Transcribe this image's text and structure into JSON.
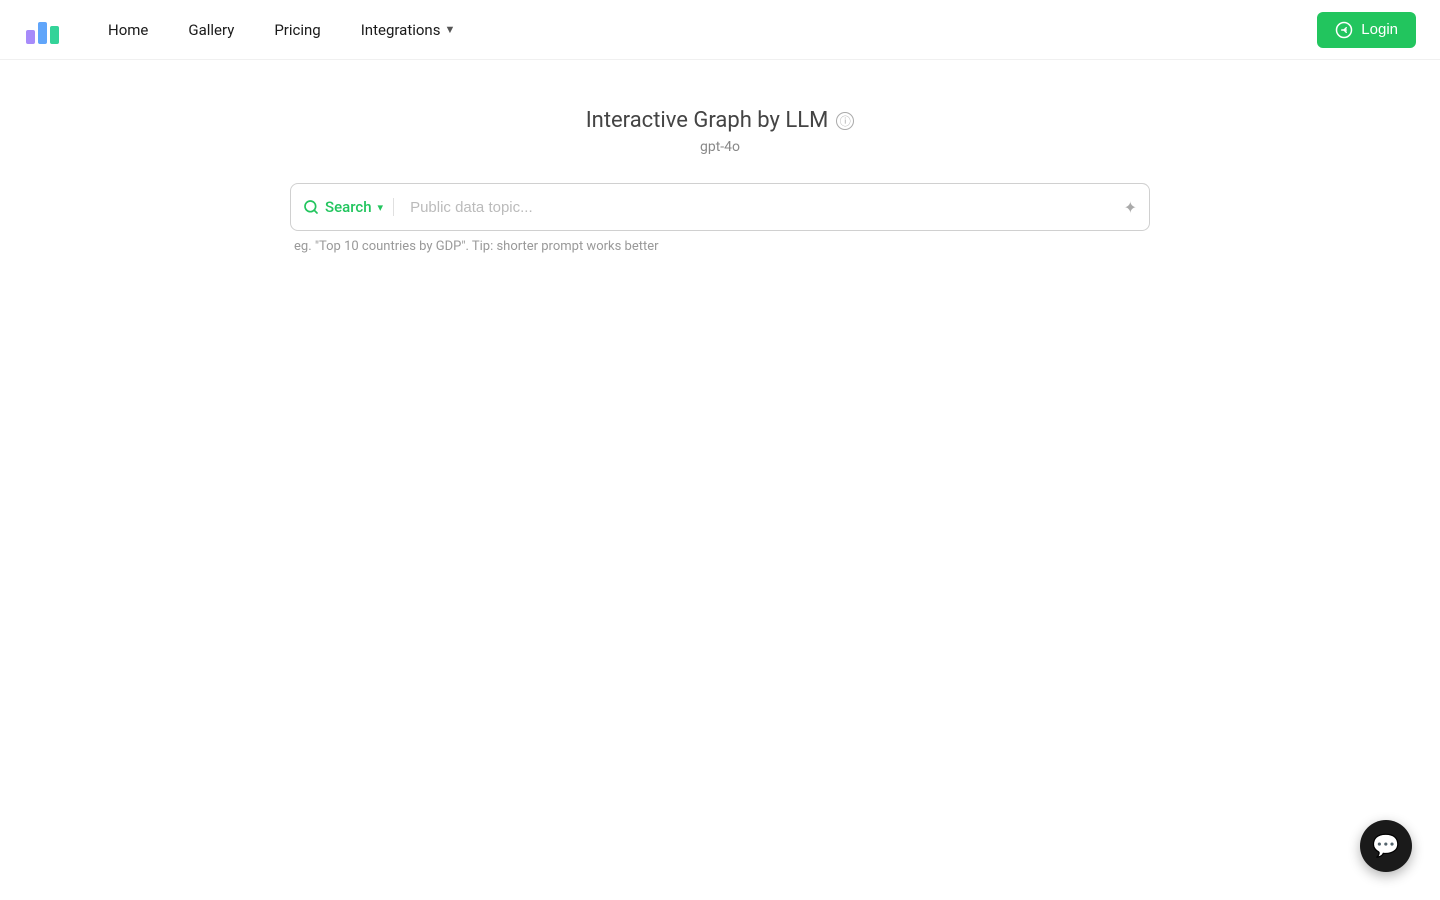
{
  "nav": {
    "links": [
      {
        "id": "home",
        "label": "Home"
      },
      {
        "id": "gallery",
        "label": "Gallery"
      },
      {
        "id": "pricing",
        "label": "Pricing"
      },
      {
        "id": "integrations",
        "label": "Integrations"
      }
    ],
    "login_label": "Login"
  },
  "main": {
    "title": "Interactive Graph by LLM",
    "subtitle": "gpt-4o",
    "search": {
      "trigger_label": "Search",
      "placeholder": "Public data topic...",
      "hint": "eg. \"Top 10 countries by GDP\". Tip: shorter prompt works better"
    }
  },
  "colors": {
    "green": "#22c55e",
    "dark": "#1a1a1a"
  }
}
